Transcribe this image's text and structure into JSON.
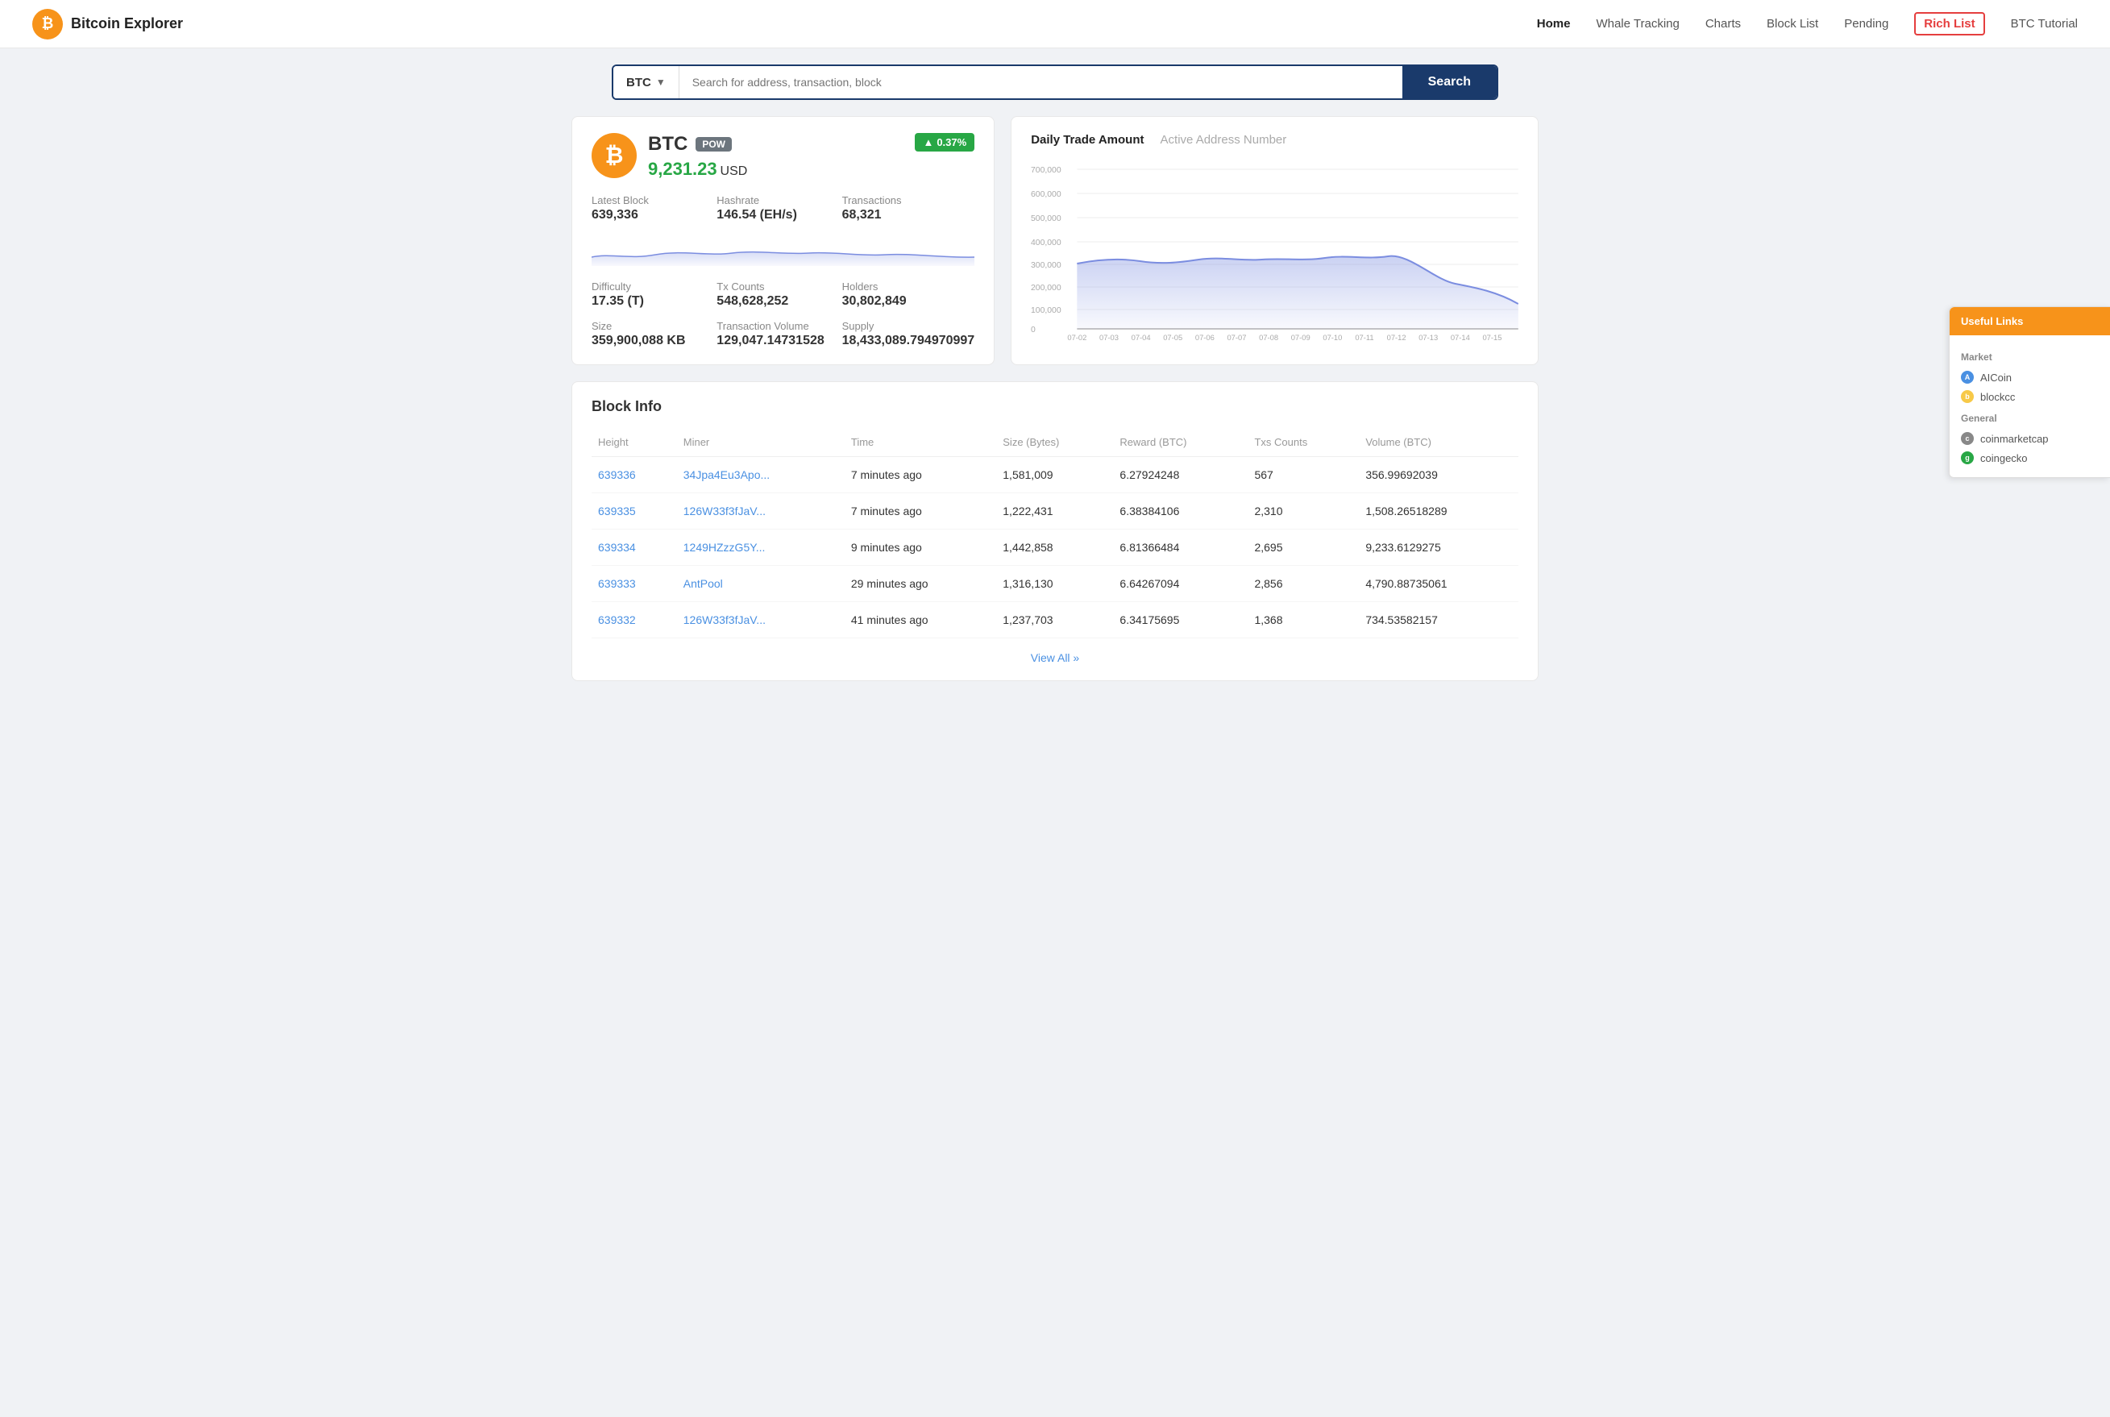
{
  "header": {
    "logo_letter": "₿",
    "title": "Bitcoin Explorer",
    "nav": [
      {
        "label": "Home",
        "active": true,
        "highlighted": false
      },
      {
        "label": "Whale Tracking",
        "active": false,
        "highlighted": false
      },
      {
        "label": "Charts",
        "active": false,
        "highlighted": false
      },
      {
        "label": "Block List",
        "active": false,
        "highlighted": false
      },
      {
        "label": "Pending",
        "active": false,
        "highlighted": false
      },
      {
        "label": "Rich List",
        "active": false,
        "highlighted": true
      },
      {
        "label": "BTC Tutorial",
        "active": false,
        "highlighted": false
      }
    ]
  },
  "search": {
    "currency": "BTC",
    "placeholder": "Search for address, transaction, block",
    "button": "Search"
  },
  "btc": {
    "name": "BTC",
    "badge": "POW",
    "price": "9,231.23",
    "currency": "USD",
    "change": "▲ 0.37%",
    "stats": [
      {
        "label": "Latest Block",
        "value": "639,336"
      },
      {
        "label": "Hashrate",
        "value": "146.54 (EH/s)"
      },
      {
        "label": "Transactions",
        "value": "68,321"
      },
      {
        "label": "Difficulty",
        "value": "17.35 (T)"
      },
      {
        "label": "Tx Counts",
        "value": "548,628,252"
      },
      {
        "label": "Holders",
        "value": "30,802,849"
      },
      {
        "label": "Size",
        "value": "359,900,088 KB"
      },
      {
        "label": "Transaction Volume",
        "value": "129,047.14731528"
      },
      {
        "label": "Supply",
        "value": "18,433,089.794970997"
      }
    ]
  },
  "chart": {
    "tab_active": "Daily Trade Amount",
    "tab_inactive": "Active Address Number",
    "y_labels": [
      "700,000",
      "600,000",
      "500,000",
      "400,000",
      "300,000",
      "200,000",
      "100,000",
      "0"
    ],
    "x_labels": [
      "07-02",
      "07-03",
      "07-04",
      "07-05",
      "07-06",
      "07-07",
      "07-08",
      "07-09",
      "07-10",
      "07-11",
      "07-12",
      "07-13",
      "07-14",
      "07-15"
    ]
  },
  "block_info": {
    "title": "Block Info",
    "columns": [
      "Height",
      "Miner",
      "Time",
      "Size (Bytes)",
      "Reward (BTC)",
      "Txs Counts",
      "Volume (BTC)"
    ],
    "rows": [
      {
        "height": "639336",
        "miner": "34Jpa4Eu3Apo...",
        "time": "7 minutes ago",
        "size": "1,581,009",
        "reward": "6.27924248",
        "txs": "567",
        "volume": "356.99692039"
      },
      {
        "height": "639335",
        "miner": "126W33f3fJaV...",
        "time": "7 minutes ago",
        "size": "1,222,431",
        "reward": "6.38384106",
        "txs": "2,310",
        "volume": "1,508.26518289"
      },
      {
        "height": "639334",
        "miner": "1249HZzzG5Y...",
        "time": "9 minutes ago",
        "size": "1,442,858",
        "reward": "6.81366484",
        "txs": "2,695",
        "volume": "9,233.6129275"
      },
      {
        "height": "639333",
        "miner": "AntPool",
        "time": "29 minutes ago",
        "size": "1,316,130",
        "reward": "6.64267094",
        "txs": "2,856",
        "volume": "4,790.88735061"
      },
      {
        "height": "639332",
        "miner": "126W33f3fJaV...",
        "time": "41 minutes ago",
        "size": "1,237,703",
        "reward": "6.34175695",
        "txs": "1,368",
        "volume": "734.53582157"
      }
    ],
    "view_all": "View All »"
  },
  "useful_links": {
    "tab": "Useful Links",
    "market_title": "Market",
    "items_market": [
      {
        "label": "AICoin",
        "color": "blue"
      },
      {
        "label": "blockcc",
        "color": "yellow"
      }
    ],
    "general_title": "General",
    "items_general": [
      {
        "label": "coinmarketcap",
        "color": "gray"
      },
      {
        "label": "coingecko",
        "color": "green"
      }
    ]
  }
}
